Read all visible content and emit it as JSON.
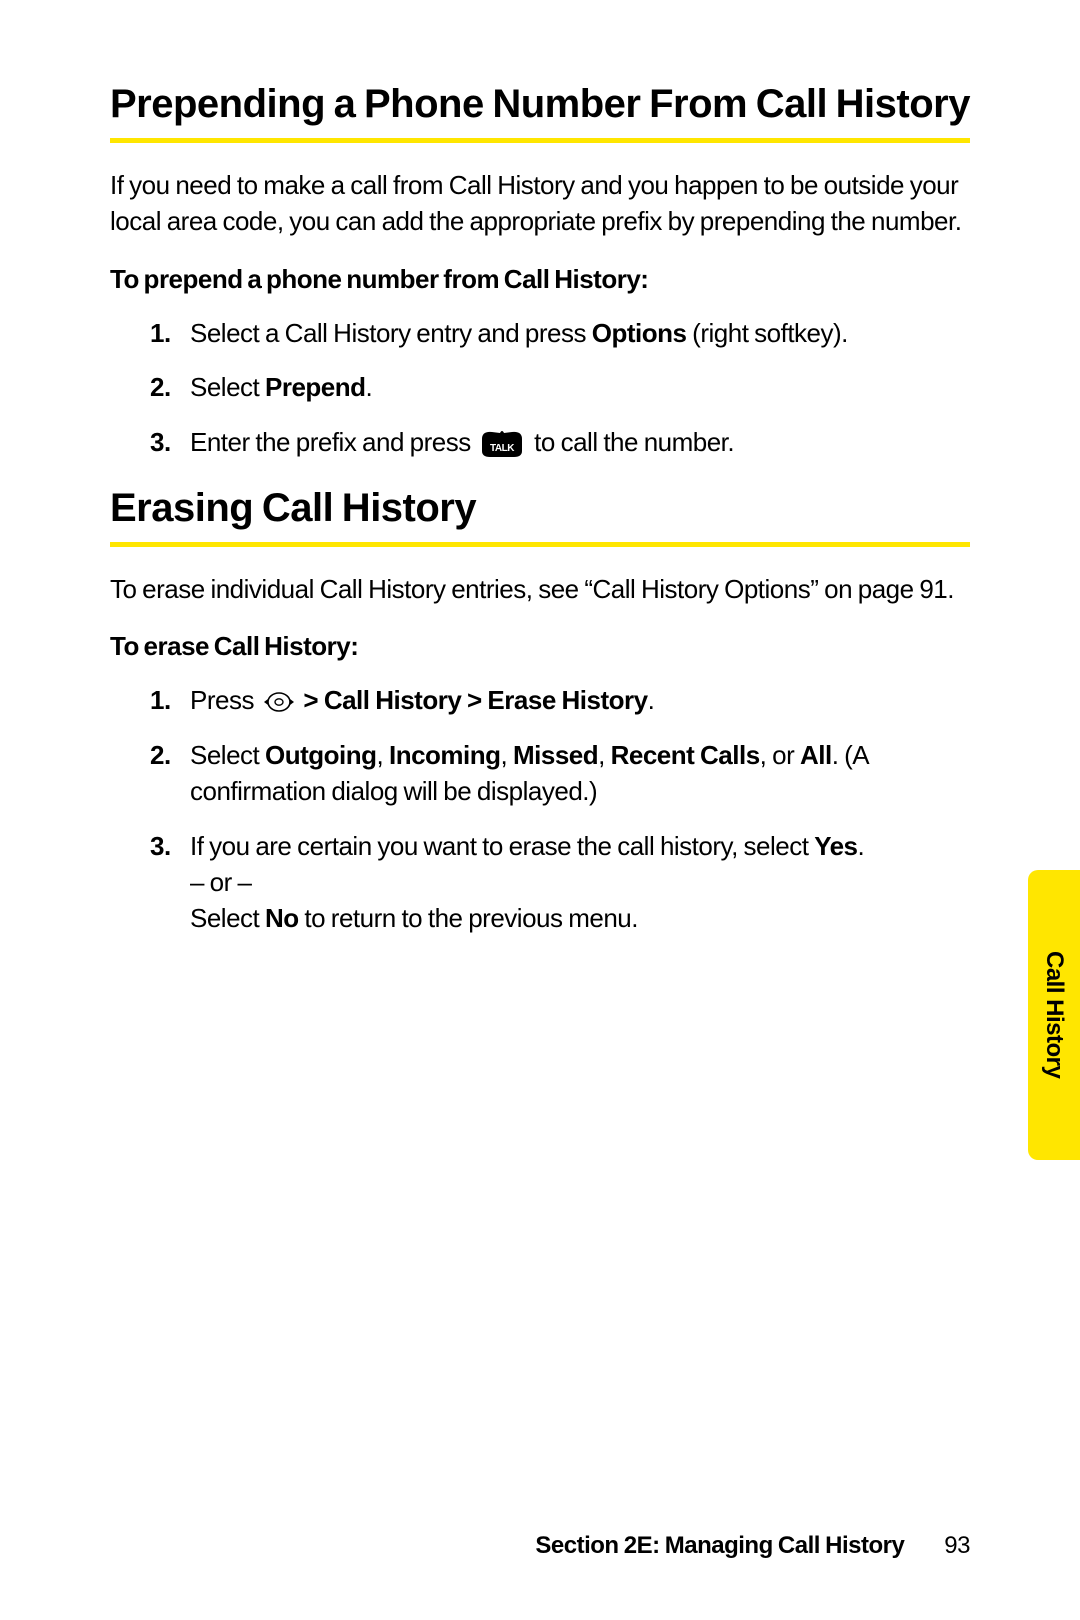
{
  "section1": {
    "heading": "Prepending a Phone Number From Call History",
    "intro": "If you need to make a call from Call History and you happen to be outside your local area code, you can add the appropriate prefix by prepending the number.",
    "subhead": "To prepend a phone number from Call History:",
    "steps": {
      "s1_pre": "Select a Call History entry and press ",
      "s1_bold": "Options",
      "s1_post": " (right softkey).",
      "s2_pre": "Select ",
      "s2_bold": "Prepend",
      "s2_post": ".",
      "s3_pre": "Enter the prefix and press ",
      "s3_post": " to call the number."
    }
  },
  "section2": {
    "heading": "Erasing Call History",
    "intro": "To erase individual Call History entries, see “Call History Options” on page 91.",
    "subhead": "To erase Call History:",
    "steps": {
      "s1_pre": "Press ",
      "s1_bold": " > Call History > Erase History",
      "s1_post": ".",
      "s2_pre": "Select ",
      "s2_b1": "Outgoing",
      "s2_c1": ", ",
      "s2_b2": "Incoming",
      "s2_c2": ", ",
      "s2_b3": "Missed",
      "s2_c3": ", ",
      "s2_b4": "Recent Calls",
      "s2_c4": ", or ",
      "s2_b5": "All",
      "s2_post1": ". (A confirmation dialog will be displayed.)",
      "s3_pre": "If you are certain you want to erase the call history, select ",
      "s3_b1": "Yes",
      "s3_post1": ".",
      "s3_or": "– or –",
      "s3_pre2": "Select ",
      "s3_b2": "No",
      "s3_post2": " to return to the previous menu."
    }
  },
  "sidetab": "Call History",
  "footer": {
    "section": "Section 2E: Managing Call History",
    "page": "93"
  },
  "icons": {
    "talk_label": "TALK"
  }
}
